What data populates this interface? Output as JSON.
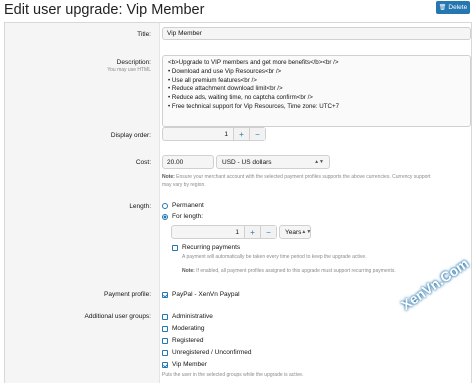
{
  "page": {
    "title": "Edit user upgrade: Vip Member",
    "delete_label": "Delete"
  },
  "form": {
    "title": {
      "label": "Title:",
      "value": "Vip Member"
    },
    "description": {
      "label": "Description:",
      "hint": "You may use HTML",
      "value": "<b>Upgrade to VIP members and get more benefits</b><br />\n• Download and use Vip Resources<br />\n• Use all premium features<br />\n• Reduce attachment download limit<br />\n• Reduce ads, waiting time, no captcha confirm<br />\n• Free technical support for Vip Resources, Time zone: UTC+7"
    },
    "display_order": {
      "label": "Display order:",
      "value": "1",
      "plus": "+",
      "minus": "−"
    },
    "cost": {
      "label": "Cost:",
      "amount": "20.00",
      "currency": "USD - US dollars",
      "note_bold": "Note:",
      "note_text": " Ensure your merchant account with the selected payment profiles supports the above currencies. Currency support",
      "note_text2": "may vary by region."
    },
    "length": {
      "label": "Length:",
      "option_permanent": "Permanent",
      "option_for_length": "For length:",
      "value": "1",
      "unit": "Years",
      "recurring_label": "Recurring payments",
      "recurring_hint": "A payment will automatically be taken every time period to keep the upgrade active.",
      "note_bold": "Note:",
      "note_text": " If enabled, all payment profiles assigned to this upgrade must support recurring payments."
    },
    "payment_profile": {
      "label": "Payment profile:",
      "option": "PayPal - XenVn Paypal"
    },
    "groups": {
      "label": "Additional user groups:",
      "items": [
        "Administrative",
        "Moderating",
        "Registered",
        "Unregistered / Unconfirmed",
        "Vip Member"
      ],
      "checked": [
        false,
        false,
        false,
        false,
        true
      ],
      "hint": "Puts the user in the selected groups while the upgrade is active."
    }
  },
  "watermark": "XenVn.Com",
  "colors": {
    "accent": "#2577b1",
    "label_bg": "#f5f5f5"
  }
}
